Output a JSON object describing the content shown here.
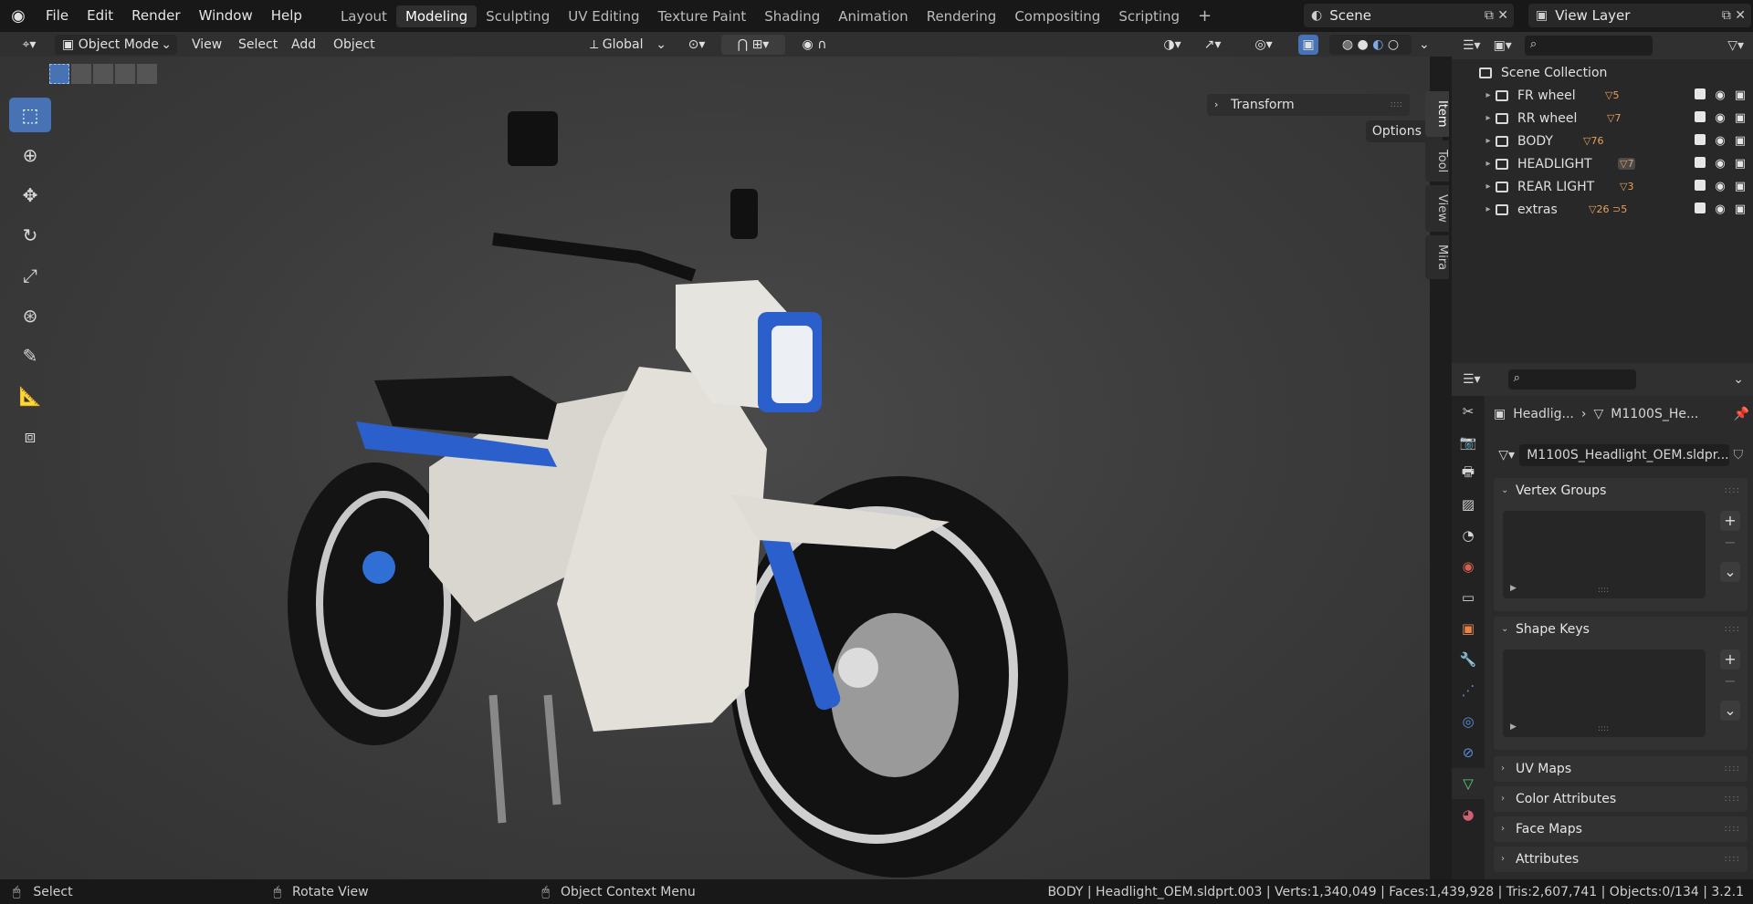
{
  "menu": [
    "File",
    "Edit",
    "Render",
    "Window",
    "Help"
  ],
  "workspaces": [
    "Layout",
    "Modeling",
    "Sculpting",
    "UV Editing",
    "Texture Paint",
    "Shading",
    "Animation",
    "Rendering",
    "Compositing",
    "Scripting"
  ],
  "active_workspace": "Modeling",
  "scene": "Scene",
  "view_layer": "View Layer",
  "header": {
    "mode": "Object Mode",
    "view": "View",
    "select": "Select",
    "add": "Add",
    "object": "Object",
    "orientation": "Global"
  },
  "viewport": {
    "options": "Options",
    "transform": "Transform"
  },
  "n_tabs": [
    "Item",
    "Tool",
    "View",
    "Mira"
  ],
  "outliner": {
    "root": "Scene Collection",
    "collections": [
      {
        "name": "FR wheel",
        "count": "5"
      },
      {
        "name": "RR wheel",
        "count": "7"
      },
      {
        "name": "BODY",
        "count": "76"
      },
      {
        "name": "HEADLIGHT",
        "count": "7"
      },
      {
        "name": "REAR LIGHT",
        "count": "3"
      },
      {
        "name": "extras",
        "count": "26",
        "count2": "5"
      }
    ]
  },
  "properties": {
    "breadcrumb_obj": "Headlig...",
    "breadcrumb_mesh": "M1100S_He...",
    "mesh_name": "M1100S_Headlight_OEM.sldpr...",
    "panels": [
      "Vertex Groups",
      "Shape Keys",
      "UV Maps",
      "Color Attributes",
      "Face Maps",
      "Attributes"
    ]
  },
  "status": {
    "select": "Select",
    "rotate": "Rotate View",
    "context": "Object Context Menu",
    "stats": "BODY | Headlight_OEM.sldprt.003 | Verts:1,340,049 | Faces:1,439,928 | Tris:2,607,741 | Objects:0/134 | 3.2.1"
  }
}
